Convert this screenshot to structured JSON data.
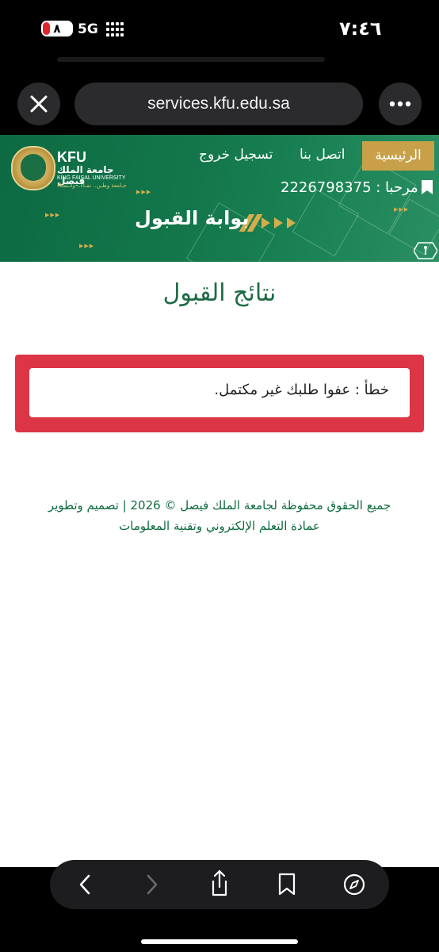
{
  "status_bar": {
    "time": "٧:٤٦",
    "battery": "٨",
    "network": "5G",
    "battery_color": "#e0242c"
  },
  "browser": {
    "url": "services.kfu.edu.sa",
    "close_icon": "close-icon",
    "more_icon": "more-icon"
  },
  "header": {
    "logo": {
      "en_abbr": "KFU",
      "ar_name": "جامعة الملك فيصل",
      "en_name": "KING FAISAL UNIVERSITY",
      "slogan": "جـامعة وطـن.. نمـاء.. وانـتمـاء"
    },
    "nav": {
      "home": "الرئيسية",
      "contact": "اتصل بنا",
      "logout": "تسجيل خروج"
    },
    "welcome": "2226798375 : مرحبا",
    "portal_title": "بوابة القبول",
    "accent_color": "#c8a04a",
    "brand_color": "#13774b"
  },
  "main": {
    "title": "نتائج القبول",
    "alert": {
      "text": "خطأ : عفوا طلبك غير مكتمل.",
      "color": "#dc3545"
    }
  },
  "footer": {
    "line1": "جميع الحقوق محفوظة لجامعة الملك فيصل © 2026 | تصميم وتطوير",
    "line2": "عمادة التعلم الإلكتروني وتقنية المعلومات"
  },
  "toolbar": {
    "icons": [
      "back-icon",
      "forward-icon",
      "share-icon",
      "bookmarks-icon",
      "compass-icon"
    ]
  }
}
